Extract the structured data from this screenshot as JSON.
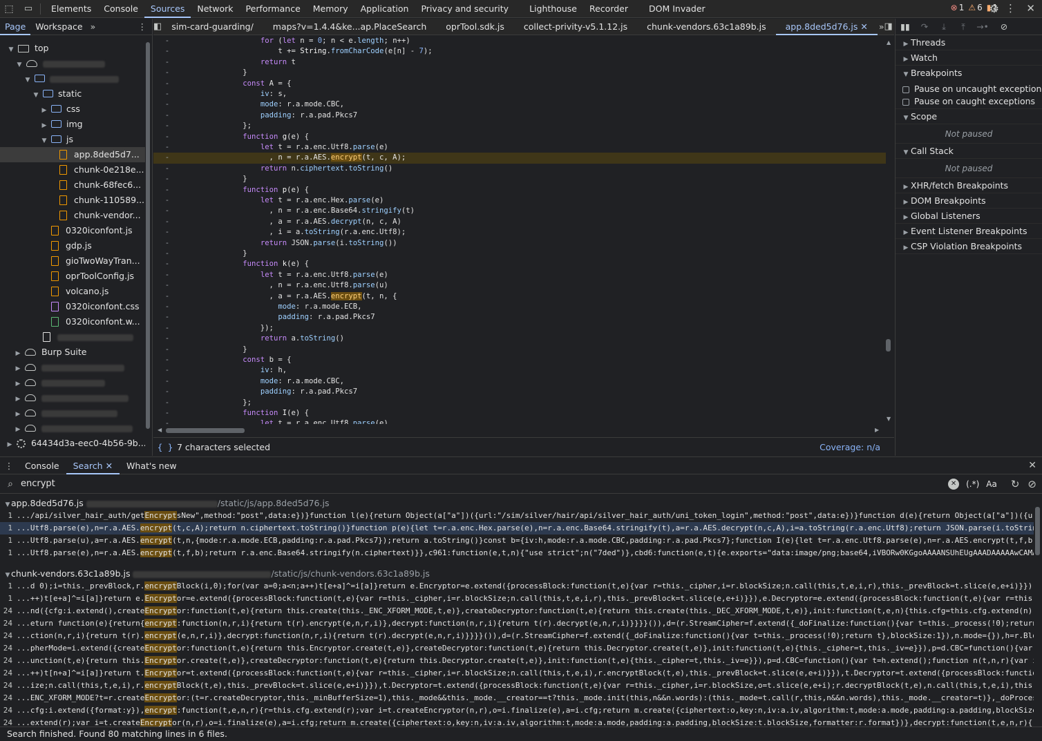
{
  "toolbar": {
    "tabs": [
      "Elements",
      "Console",
      "Sources",
      "Network",
      "Performance",
      "Memory",
      "Application",
      "Privacy and security",
      "Lighthouse",
      "Recorder",
      "DOM Invader"
    ],
    "active_tab": "Sources",
    "errors": "1",
    "warnings": "6",
    "issues": "1"
  },
  "navigator": {
    "tabs": [
      "Page",
      "Workspace"
    ],
    "top": "top",
    "static": "static",
    "css": "css",
    "img": "img",
    "js": "js",
    "js_files": [
      "app.8ded5d7...",
      "chunk-0e218e...",
      "chunk-68fec6...",
      "chunk-110589...",
      "chunk-vendor..."
    ],
    "root_files": [
      "0320iconfont.js",
      "gdp.js",
      "gioTwoWayTran...",
      "oprToolConfig.js",
      "volcano.js",
      "0320iconfont.css",
      "0320iconfont.w..."
    ],
    "burp": "Burp Suite",
    "frame": "64434d3a-eec0-4b56-9b..."
  },
  "editor": {
    "tabs": [
      "sim-card-guarding/",
      "maps?v=1.4.4&ke...ap.PlaceSearch",
      "oprTool.sdk.js",
      "collect-privity-v5.1.12.js",
      "chunk-vendors.63c1a89b.js",
      "app.8ded5d76.js"
    ],
    "active_tab": "app.8ded5d76.js",
    "status": "7 characters selected",
    "coverage": "Coverage: n/a"
  },
  "debugger": {
    "sections": {
      "threads": "Threads",
      "watch": "Watch",
      "breakpoints": "Breakpoints",
      "scope": "Scope",
      "call_stack": "Call Stack"
    },
    "pause_uncaught": "Pause on uncaught exceptions",
    "pause_caught": "Pause on caught exceptions",
    "not_paused": "Not paused",
    "extra": [
      "XHR/fetch Breakpoints",
      "DOM Breakpoints",
      "Global Listeners",
      "Event Listener Breakpoints",
      "CSP Violation Breakpoints"
    ]
  },
  "drawer": {
    "tabs": [
      "Console",
      "Search",
      "What's new"
    ],
    "active_tab": "Search",
    "query": "encrypt",
    "regex": "(.*)",
    "case": "Aa",
    "file1": {
      "name": "app.8ded5d76.js",
      "path": "/static/js/app.8ded5d76.js"
    },
    "file2": {
      "name": "chunk-vendors.63c1a89b.js",
      "path": "/static/js/chunk-vendors.63c1a89b.js"
    },
    "status": "Search finished.  Found 80 matching lines in 6 files."
  }
}
